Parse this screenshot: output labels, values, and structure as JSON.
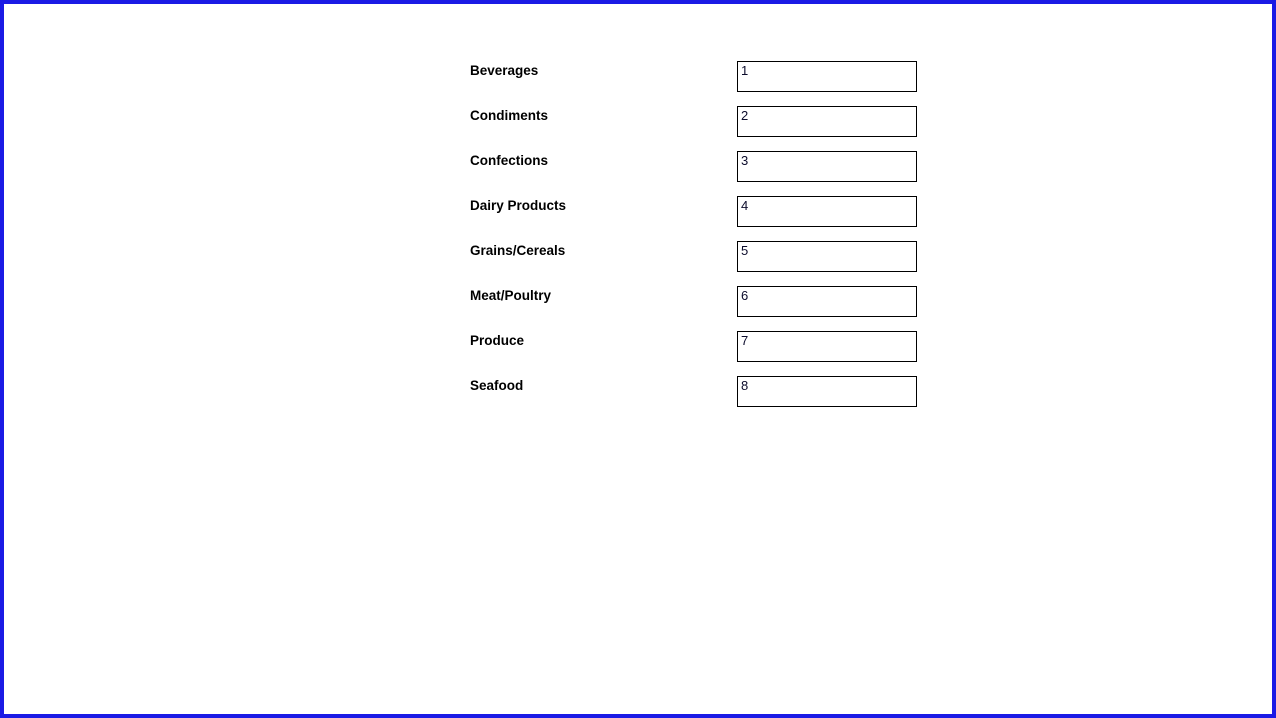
{
  "page": {
    "highlight_border_color": "#1a1ae5",
    "background_color": "#ffffff",
    "text_color": "#000000",
    "input_border_color": "#000000",
    "input_value_color": "#0b0b2b"
  },
  "form": {
    "fields": [
      {
        "label": "Beverages",
        "value": "1",
        "placeholder": ""
      },
      {
        "label": "Condiments",
        "value": "2",
        "placeholder": ""
      },
      {
        "label": "Confections",
        "value": "3",
        "placeholder": ""
      },
      {
        "label": "Dairy Products",
        "value": "4",
        "placeholder": ""
      },
      {
        "label": "Grains/Cereals",
        "value": "5",
        "placeholder": ""
      },
      {
        "label": "Meat/Poultry",
        "value": "6",
        "placeholder": ""
      },
      {
        "label": "Produce",
        "value": "7",
        "placeholder": ""
      },
      {
        "label": "Seafood",
        "value": "8",
        "placeholder": ""
      }
    ]
  }
}
